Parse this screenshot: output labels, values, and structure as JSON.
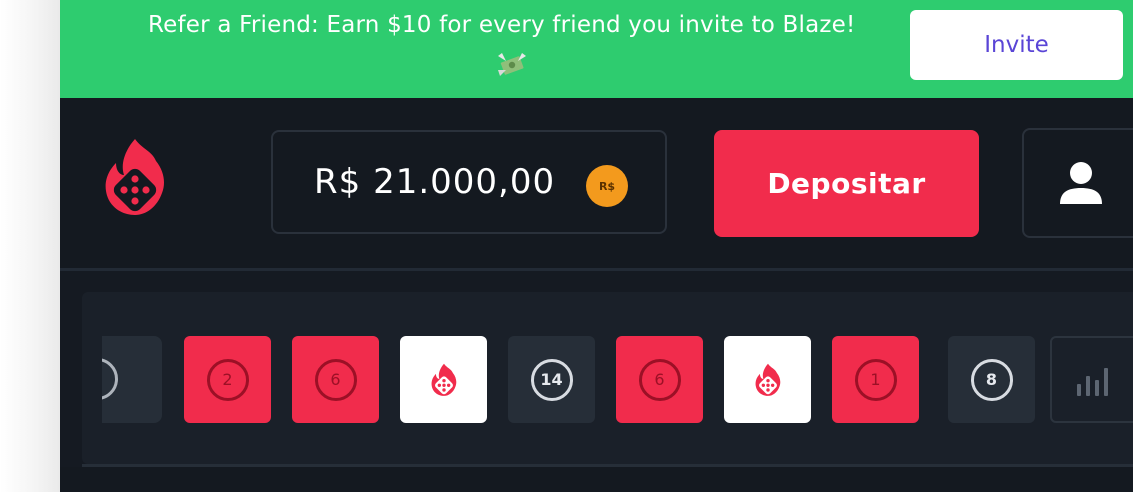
{
  "banner": {
    "text": "Refer a Friend: Earn $10 for every friend you invite to Blaze!",
    "emoji": "money-with-wings",
    "invite_label": "Invite"
  },
  "header": {
    "logo": "blaze-dice-flame-logo",
    "balance": "R$ 21.000,00",
    "currency_badge": "R$",
    "deposit_label": "Depositar",
    "profile_icon": "user-icon"
  },
  "history": {
    "tiles": [
      {
        "color": "red",
        "value": "2"
      },
      {
        "color": "red",
        "value": "6"
      },
      {
        "color": "white",
        "value": ""
      },
      {
        "color": "black",
        "value": "14"
      },
      {
        "color": "red",
        "value": "6"
      },
      {
        "color": "white",
        "value": ""
      },
      {
        "color": "red",
        "value": "1"
      },
      {
        "color": "black",
        "value": "8"
      }
    ],
    "stats_icon": "bar-chart-icon"
  },
  "colors": {
    "banner_green": "#2ecc6f",
    "accent_red": "#f12c4c",
    "background": "#151a22",
    "invite_text": "#5a45d6",
    "coin": "#f39a1d"
  }
}
